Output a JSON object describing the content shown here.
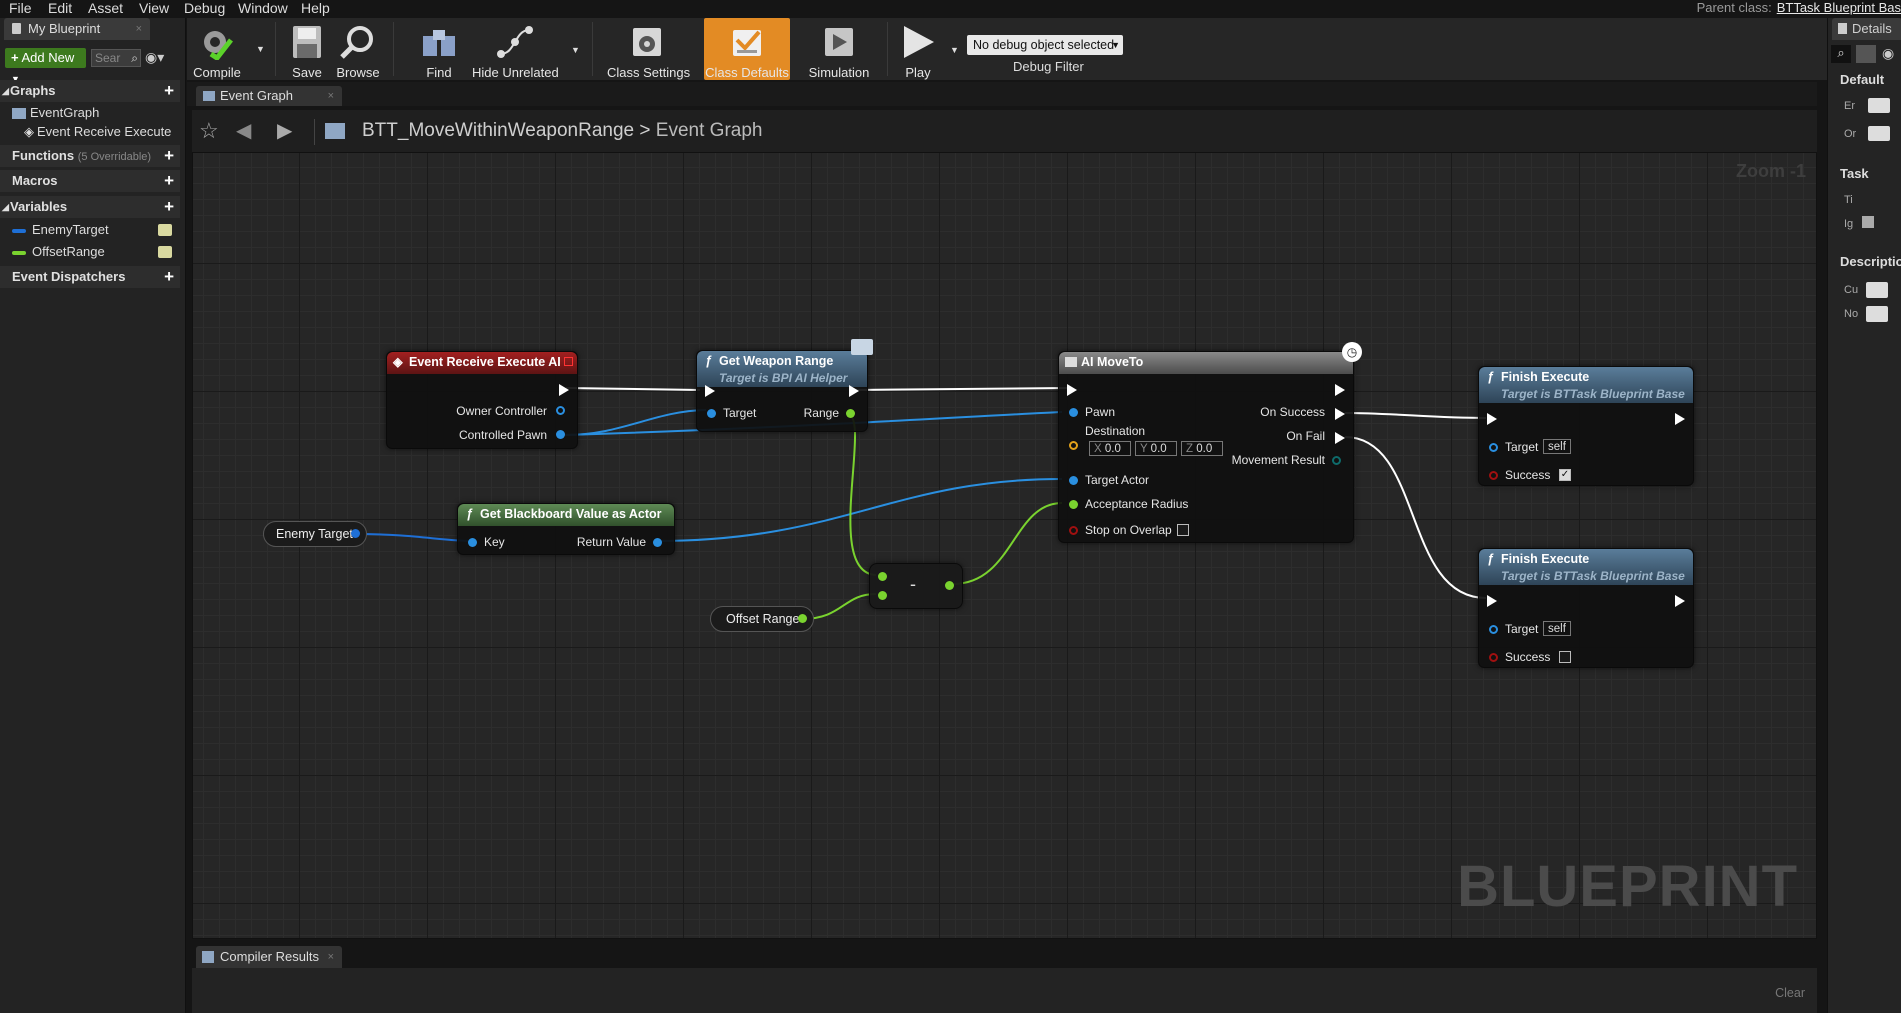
{
  "menu": [
    "File",
    "Edit",
    "Asset",
    "View",
    "Debug",
    "Window",
    "Help"
  ],
  "parent_class": {
    "label": "Parent class:",
    "value": "BTTask Blueprint Bas"
  },
  "left_panel": {
    "tab": "My Blueprint",
    "add_new": "Add New",
    "search_placeholder": "Sear",
    "graphs_label": "Graphs",
    "graph_items": [
      "EventGraph",
      "Event Receive Execute"
    ],
    "functions_label": "Functions",
    "functions_hint": "(5 Overridable)",
    "macros_label": "Macros",
    "variables_label": "Variables",
    "variables": [
      {
        "name": "EnemyTarget",
        "color": "#1e6fd6"
      },
      {
        "name": "OffsetRange",
        "color": "#7ad32f"
      }
    ],
    "dispatchers_label": "Event Dispatchers"
  },
  "toolbar": {
    "compile": "Compile",
    "save": "Save",
    "browse": "Browse",
    "find": "Find",
    "hide_unrelated": "Hide Unrelated",
    "class_settings": "Class Settings",
    "class_defaults": "Class Defaults",
    "simulation": "Simulation",
    "play": "Play",
    "debug_select": "No debug object selected",
    "debug_filter": "Debug Filter"
  },
  "graph": {
    "tab": "Event Graph",
    "breadcrumb_root": "BTT_MoveWithinWeaponRange",
    "breadcrumb_sep": ">",
    "breadcrumb_current": "Event Graph",
    "zoom": "Zoom -1",
    "watermark": "BLUEPRINT"
  },
  "nodes": {
    "event_receive": {
      "title": "Event Receive Execute AI",
      "pins": [
        "Owner Controller",
        "Controlled Pawn"
      ]
    },
    "get_weapon_range": {
      "title": "Get Weapon Range",
      "subtitle": "Target is BPI AI Helper",
      "in_pin": "Target",
      "out_pin": "Range"
    },
    "ai_moveto": {
      "title": "AI MoveTo",
      "inputs": [
        "Pawn",
        "Destination",
        "Target Actor",
        "Acceptance Radius",
        "Stop on Overlap"
      ],
      "outputs": [
        "On Success",
        "On Fail",
        "Movement Result"
      ],
      "dest": {
        "x_label": "X",
        "x": "0.0",
        "y_label": "Y",
        "y": "0.0",
        "z_label": "Z",
        "z": "0.0"
      }
    },
    "get_blackboard": {
      "title": "Get Blackboard Value as Actor",
      "in_pin": "Key",
      "out_pin": "Return Value"
    },
    "enemy_target": {
      "label": "Enemy Target"
    },
    "offset_range": {
      "label": "Offset Range"
    },
    "subtract": {
      "symbol": "-"
    },
    "finish_execute_1": {
      "title": "Finish Execute",
      "subtitle": "Target is BTTask Blueprint Base",
      "target": "Target",
      "target_val": "self",
      "success": "Success",
      "checked": true
    },
    "finish_execute_2": {
      "title": "Finish Execute",
      "subtitle": "Target is BTTask Blueprint Base",
      "target": "Target",
      "target_val": "self",
      "success": "Success",
      "checked": false
    }
  },
  "right_panel": {
    "tab": "Details",
    "default_label": "Default",
    "default_rows": [
      "Er",
      "Or"
    ],
    "task_label": "Task",
    "task_rows": [
      "Ti",
      "Ig"
    ],
    "description_label": "Descriptio",
    "description_rows": [
      "Cu",
      "No"
    ]
  },
  "bottom": {
    "tab": "Compiler Results",
    "clear": "Clear"
  }
}
